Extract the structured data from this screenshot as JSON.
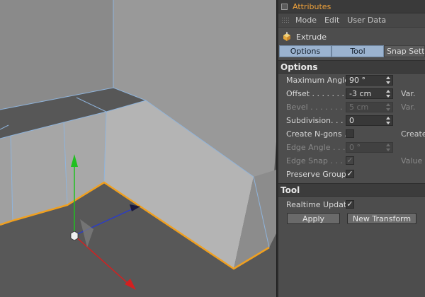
{
  "panel": {
    "title": "Attributes",
    "menu": [
      "Mode",
      "Edit",
      "User Data"
    ],
    "object_name": "Extrude",
    "tabs": [
      {
        "label": "Options",
        "active": true
      },
      {
        "label": "Tool",
        "active": true
      },
      {
        "label": "Snap Settings",
        "active": false
      }
    ],
    "options_section": {
      "title": "Options",
      "maximum_angle": {
        "label": "Maximum Angle",
        "value": "90 °"
      },
      "offset": {
        "label": "Offset . . . . . . . .",
        "value": "-3 cm",
        "right_label": "Var."
      },
      "bevel": {
        "label": "Bevel . . . . . . . . .",
        "value": "5 cm",
        "right_label": "Var."
      },
      "subdivision": {
        "label": "Subdivision. . . . .",
        "value": "0"
      },
      "create_ngons": {
        "label": "Create N-gons . .",
        "checked": false,
        "right_label": "Create"
      },
      "edge_angle": {
        "label": "Edge Angle . . . .",
        "value": "0 °"
      },
      "edge_snap": {
        "label": "Edge Snap . . . . .",
        "checked": true,
        "right_label": "Value"
      },
      "preserve_groups": {
        "label": "Preserve Groups",
        "checked": true
      }
    },
    "tool_section": {
      "title": "Tool",
      "realtime_update": {
        "label": "Realtime Update",
        "checked": true
      },
      "apply_label": "Apply",
      "new_transform_label": "New Transform"
    }
  },
  "colors": {
    "title_accent": "#f0a23a",
    "tab_active": "#9bb3cf",
    "edge_highlight": "#8fb4dc",
    "selection_edge": "#f0a020",
    "axis_x": "#d42020",
    "axis_y": "#20c020",
    "axis_z": "#2a3cc8"
  },
  "check_glyph": "✓"
}
